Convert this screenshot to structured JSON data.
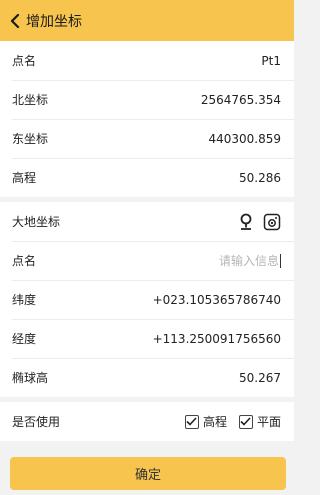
{
  "header": {
    "title": "增加坐标"
  },
  "coords": {
    "name_label": "点名",
    "name_value": "Pt1",
    "north_label": "北坐标",
    "north_value": "2564765.354",
    "east_label": "东坐标",
    "east_value": "440300.859",
    "elev_label": "高程",
    "elev_value": "50.286"
  },
  "geodetic": {
    "title": "大地坐标",
    "name_label": "点名",
    "name_placeholder": "请输入信息",
    "name_value": "",
    "lat_label": "纬度",
    "lat_value": "+023.105365786740",
    "lon_label": "经度",
    "lon_value": "+113.250091756560",
    "ell_label": "椭球高",
    "ell_value": "50.267"
  },
  "usage": {
    "label": "是否使用",
    "options": [
      {
        "label": "高程",
        "checked": true
      },
      {
        "label": "平面",
        "checked": true
      }
    ]
  },
  "footer": {
    "confirm_label": "确定"
  }
}
